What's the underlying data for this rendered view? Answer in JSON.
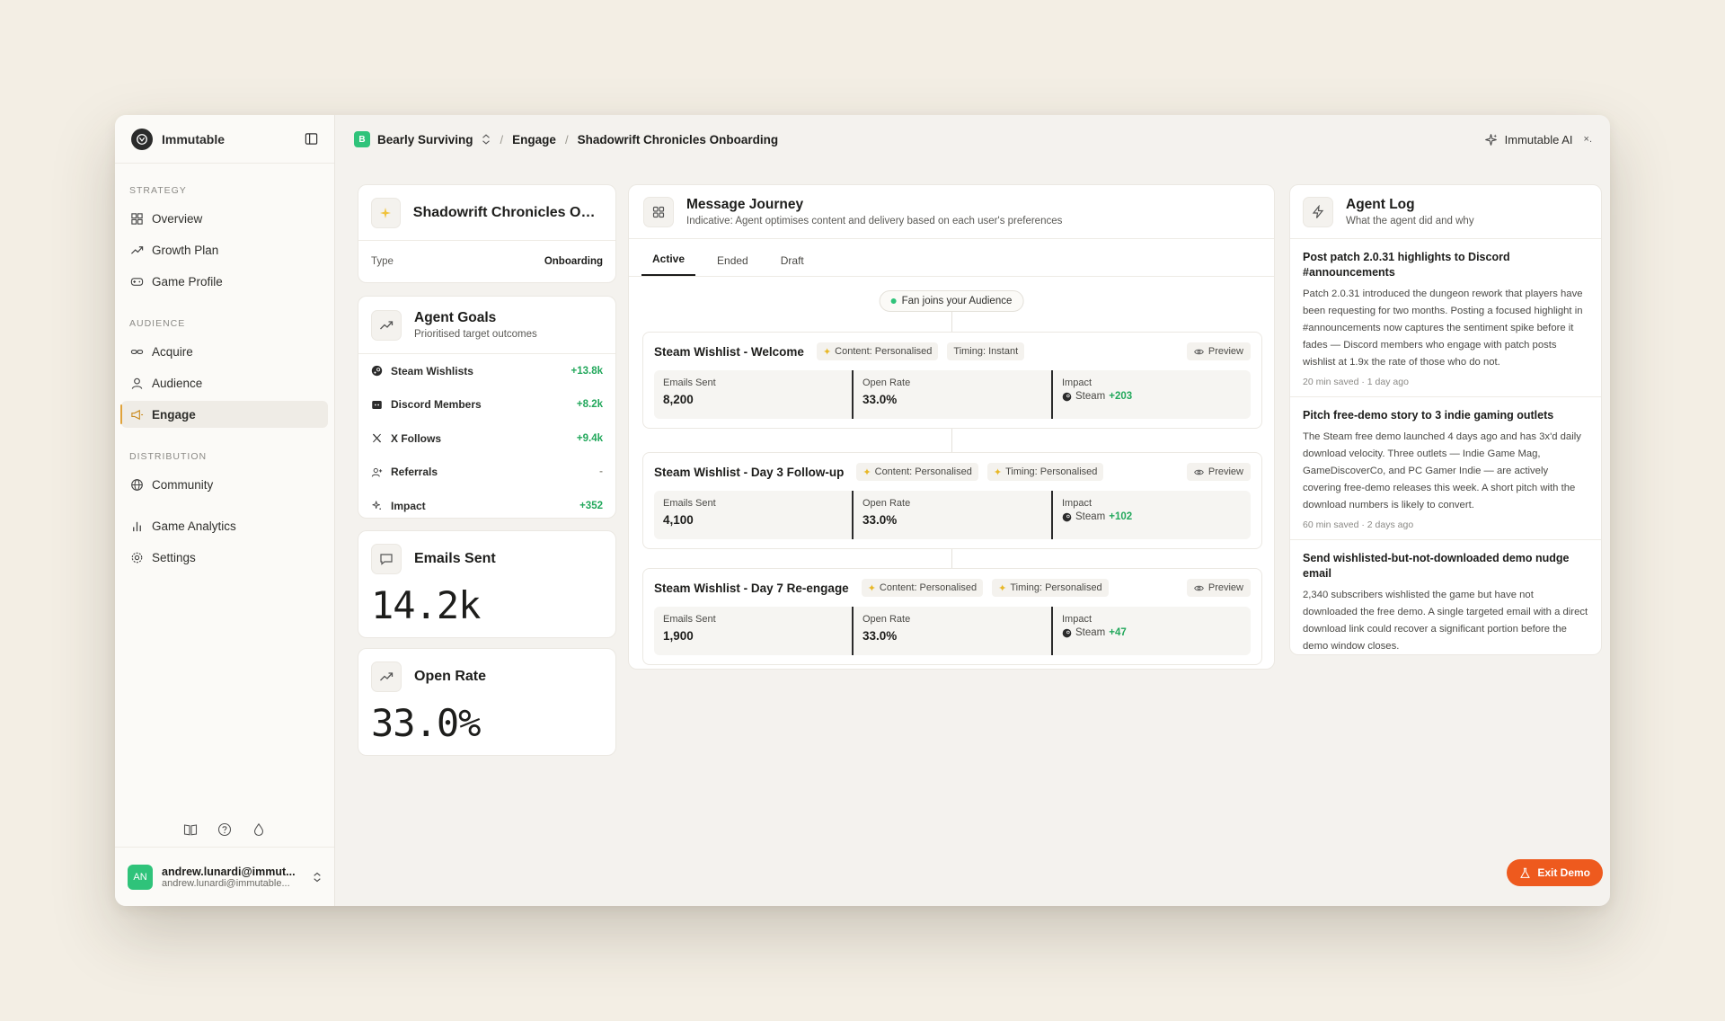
{
  "brand": {
    "name": "Immutable"
  },
  "nav": {
    "sections": [
      {
        "label": "STRATEGY",
        "items": [
          "Overview",
          "Growth Plan",
          "Game Profile"
        ]
      },
      {
        "label": "AUDIENCE",
        "items": [
          "Acquire",
          "Audience",
          "Engage"
        ]
      },
      {
        "label": "DISTRIBUTION",
        "items": [
          "Community",
          "Game Analytics",
          "Settings"
        ]
      }
    ],
    "active": "Engage"
  },
  "user": {
    "initials": "AN",
    "name": "andrew.lunardi@immut...",
    "email": "andrew.lunardi@immutable..."
  },
  "topbar": {
    "game_badge": "B",
    "game_name": "Bearly Surviving",
    "crumb_engage": "Engage",
    "crumb_page": "Shadowrift Chronicles Onboarding",
    "ai_label": "Immutable AI",
    "close": "×."
  },
  "campaign": {
    "title": "Shadowrift Chronicles Onb...",
    "type_key": "Type",
    "type_value": "Onboarding"
  },
  "goals": {
    "title": "Agent Goals",
    "subtitle": "Prioritised target outcomes",
    "items": [
      {
        "label": "Steam Wishlists",
        "value": "+13.8k"
      },
      {
        "label": "Discord Members",
        "value": "+8.2k"
      },
      {
        "label": "X Follows",
        "value": "+9.4k"
      },
      {
        "label": "Referrals",
        "value": "-"
      },
      {
        "label": "Impact",
        "value": "+352"
      }
    ]
  },
  "metrics": {
    "emails": {
      "label": "Emails Sent",
      "value": "14.2k"
    },
    "open_rate": {
      "label": "Open Rate",
      "value": "33.0%"
    }
  },
  "journey": {
    "title": "Message Journey",
    "subtitle": "Indicative: Agent optimises content and delivery based on each user's preferences",
    "tabs": [
      "Active",
      "Ended",
      "Draft"
    ],
    "fan_pill": "Fan joins your Audience",
    "preview_label": "Preview",
    "steps": [
      {
        "name": "Steam Wishlist - Welcome",
        "content": "Content: Personalised",
        "timing": "Timing: Instant",
        "k1": "Emails Sent",
        "v1": "8,200",
        "k2": "Open Rate",
        "v2": "33.0%",
        "k3": "Impact",
        "imp_label": "Steam",
        "imp_value": "+203"
      },
      {
        "name": "Steam Wishlist - Day 3 Follow-up",
        "content": "Content: Personalised",
        "timing": "Timing: Personalised",
        "k1": "Emails Sent",
        "v1": "4,100",
        "k2": "Open Rate",
        "v2": "33.0%",
        "k3": "Impact",
        "imp_label": "Steam",
        "imp_value": "+102"
      },
      {
        "name": "Steam Wishlist - Day 7 Re-engage",
        "content": "Content: Personalised",
        "timing": "Timing: Personalised",
        "k1": "Emails Sent",
        "v1": "1,900",
        "k2": "Open Rate",
        "v2": "33.0%",
        "k3": "Impact",
        "imp_label": "Steam",
        "imp_value": "+47"
      }
    ]
  },
  "log": {
    "title": "Agent Log",
    "subtitle": "What the agent did and why",
    "entries": [
      {
        "title": "Post patch 2.0.31 highlights to Discord #announcements",
        "body": "Patch 2.0.31 introduced the dungeon rework that players have been requesting for two months. Posting a focused highlight in #announcements now captures the sentiment spike before it fades — Discord members who engage with patch posts wishlist at 1.9x the rate of those who do not.",
        "meta": "20 min saved · 1 day ago"
      },
      {
        "title": "Pitch free-demo story to 3 indie gaming outlets",
        "body": "The Steam free demo launched 4 days ago and has 3x'd daily download velocity. Three outlets — Indie Game Mag, GameDiscoverCo, and PC Gamer Indie — are actively covering free-demo releases this week. A short pitch with the download numbers is likely to convert.",
        "meta": "60 min saved · 2 days ago"
      },
      {
        "title": "Send wishlisted-but-not-downloaded demo nudge email",
        "body": "2,340 subscribers wishlisted the game but have not downloaded the free demo. A single targeted email with a direct download link could recover a significant portion before the demo window closes.",
        "meta": ""
      }
    ]
  },
  "exit_label": "Exit Demo",
  "colors": {
    "accent_green": "#23a85c",
    "exit_orange": "#ee5a1e",
    "active_marker": "#e0a23a"
  }
}
